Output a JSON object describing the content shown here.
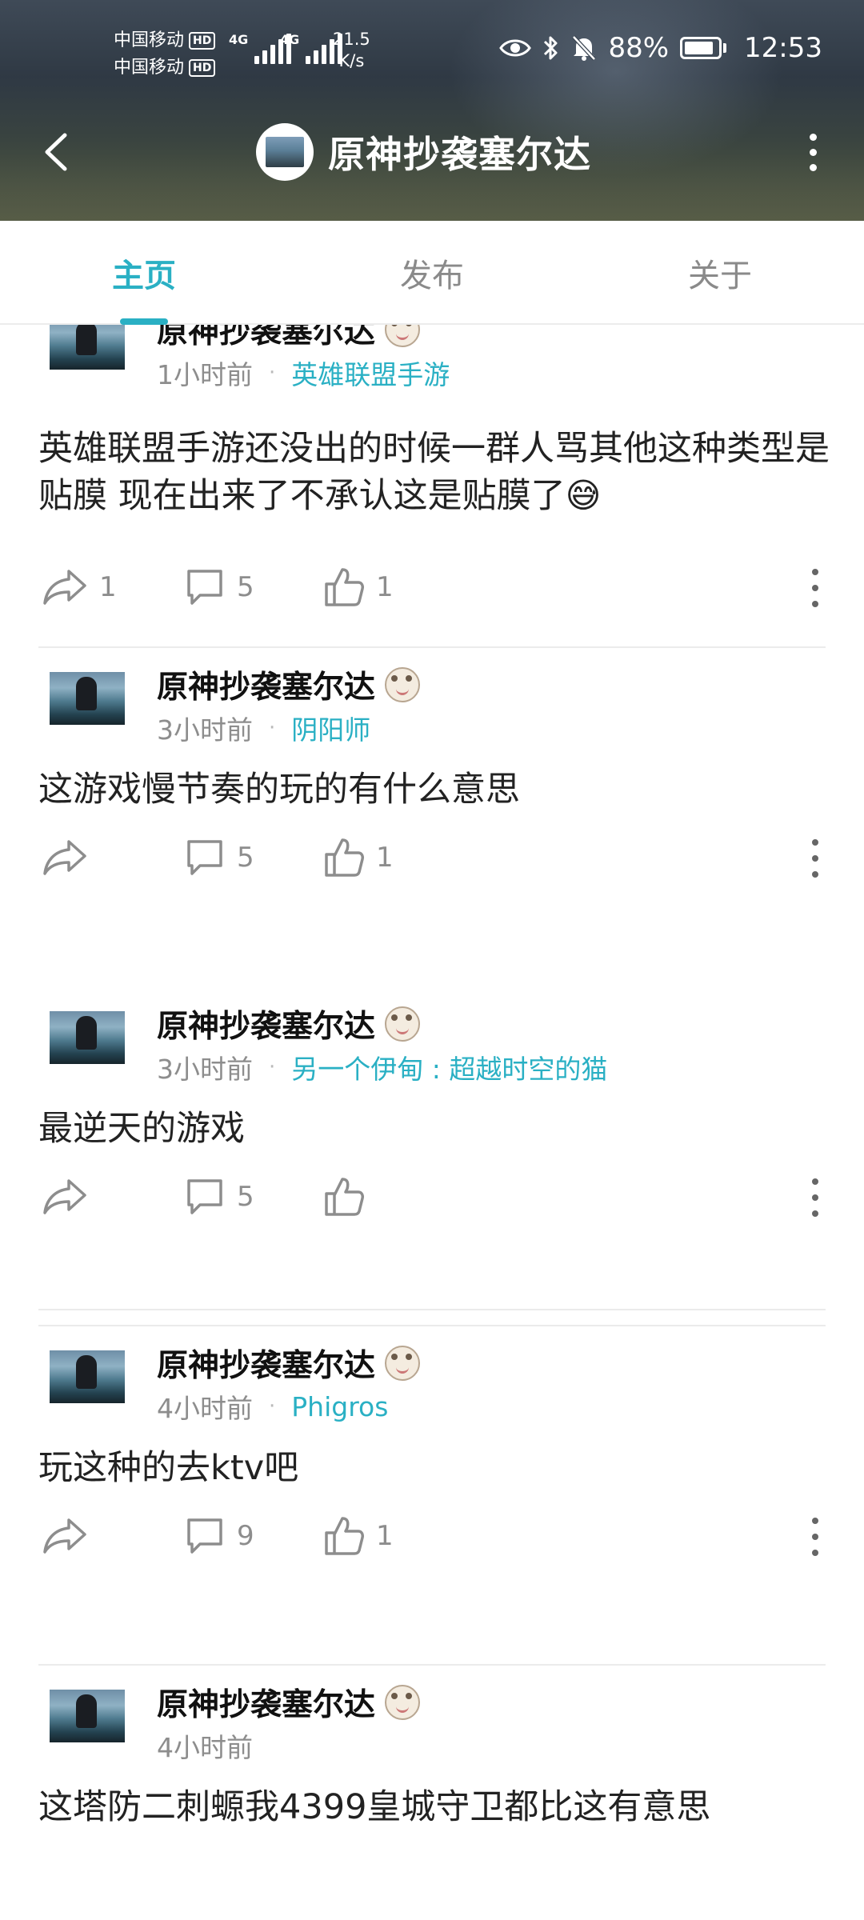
{
  "status_bar": {
    "carrier1": "中国移动",
    "carrier2": "中国移动",
    "hd": "HD",
    "net1": "4G",
    "net2": "4G",
    "speed_value": "21.5",
    "speed_unit": "K/s",
    "battery": "88%",
    "battery_level": 0.88,
    "time": "12:53",
    "icons": [
      "eye-icon",
      "bluetooth-icon",
      "mute-bell-icon",
      "battery-icon"
    ]
  },
  "nav": {
    "title": "原神抄袭塞尔达",
    "icons": [
      "back-arrow-icon",
      "more-vertical-icon"
    ]
  },
  "tabs": [
    {
      "label": "主页",
      "active": true
    },
    {
      "label": "发布",
      "active": false
    },
    {
      "label": "关于",
      "active": false
    }
  ],
  "posts": [
    {
      "username": "原神抄袭塞尔达",
      "time": "1小时前",
      "topic": "英雄联盟手游",
      "text": "英雄联盟手游还没出的时候一群人骂其他这种类型是贴膜 现在出来了不承认这是贴膜了😅",
      "shares": "1",
      "comments": "5",
      "likes": "1"
    },
    {
      "username": "原神抄袭塞尔达",
      "time": "3小时前",
      "topic": "阴阳师",
      "text": "这游戏慢节奏的玩的有什么意思",
      "shares": "",
      "comments": "5",
      "likes": "1"
    },
    {
      "username": "原神抄袭塞尔达",
      "time": "3小时前",
      "topic": "另一个伊甸 : 超越时空的猫",
      "text": "最逆天的游戏",
      "shares": "",
      "comments": "5",
      "likes": ""
    },
    {
      "username": "原神抄袭塞尔达",
      "time": "4小时前",
      "topic": "Phigros",
      "text": "玩这种的去ktv吧",
      "shares": "",
      "comments": "9",
      "likes": "1"
    },
    {
      "username": "原神抄袭塞尔达",
      "time": "4小时前",
      "topic": "",
      "text": "这塔防二刺螈我4399皇城守卫都比这有意思"
    }
  ],
  "colors": {
    "accent": "#2ab0c4",
    "muted": "#8d8d8d",
    "text": "#222222"
  }
}
